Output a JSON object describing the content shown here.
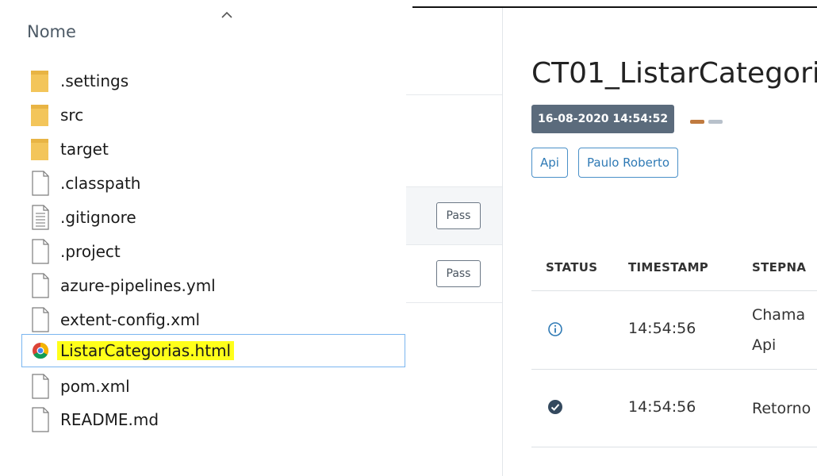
{
  "explorer": {
    "column_header": "Nome",
    "sort_icon": "chevron-up-icon",
    "files": [
      {
        "name": ".settings",
        "type": "folder"
      },
      {
        "name": "src",
        "type": "folder"
      },
      {
        "name": "target",
        "type": "folder"
      },
      {
        "name": ".classpath",
        "type": "file"
      },
      {
        "name": ".gitignore",
        "type": "text-file"
      },
      {
        "name": ".project",
        "type": "file"
      },
      {
        "name": "azure-pipelines.yml",
        "type": "file"
      },
      {
        "name": "extent-config.xml",
        "type": "file"
      },
      {
        "name": "ListarCategorias.html",
        "type": "chrome-html",
        "selected": true
      },
      {
        "name": "pom.xml",
        "type": "file"
      },
      {
        "name": "README.md",
        "type": "file"
      }
    ],
    "highlight_color": "#ffff1a",
    "folder_color": "#f3c55a"
  },
  "report": {
    "test_list": {
      "badges": [
        "Pass",
        "Pass"
      ]
    },
    "test_title": "CT01_ListarCategori",
    "timestamp": "16-08-2020 14:54:52",
    "tags": [
      "Api",
      "Paulo Roberto"
    ],
    "table": {
      "headers": {
        "status": "STATUS",
        "timestamp": "TIMESTAMP",
        "stepname": "STEPNA"
      },
      "rows": [
        {
          "status_icon": "info-icon",
          "time": "14:54:56",
          "step_line1": "Chama",
          "step_line2": "Api"
        },
        {
          "status_icon": "check-circle-icon",
          "time": "14:54:56",
          "step_line1": "Retorno",
          "step_line2": ""
        }
      ]
    },
    "colors": {
      "badge_bg": "#5b6b7c",
      "tag_border": "#4a90c8",
      "dash_primary": "#c07a3f",
      "dash_secondary": "#b8c1cb",
      "info_color": "#2f7ab5",
      "pass_color": "#34495e"
    }
  }
}
